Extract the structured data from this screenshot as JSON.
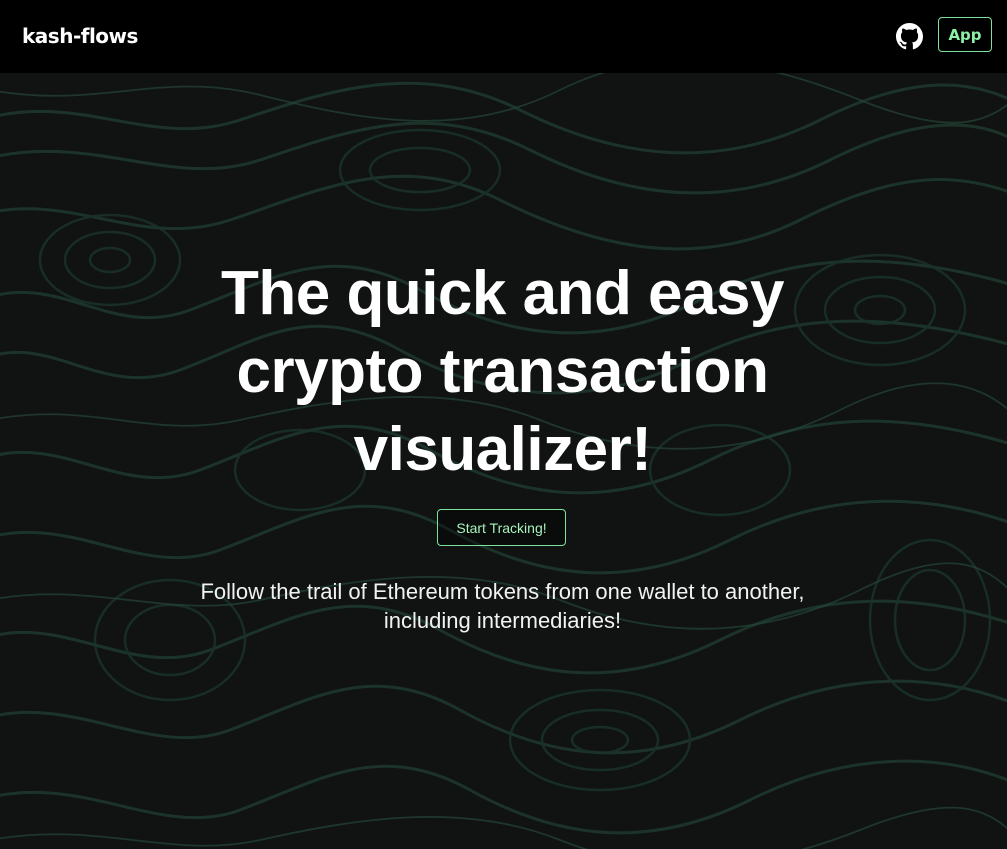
{
  "navbar": {
    "brand": "kash-flows",
    "github_icon": "github-icon",
    "app_button_label": "App"
  },
  "hero": {
    "title": "The quick and easy crypto transaction visualizer!",
    "cta_label": "Start Tracking!",
    "subtitle": "Follow the trail of Ethereum tokens from one wallet to another, including intermediaries!"
  },
  "colors": {
    "background": "#101312",
    "navbar": "#000000",
    "accent_green": "#7ee29c",
    "topo_lines": "#1f3a30",
    "text": "#ffffff"
  }
}
